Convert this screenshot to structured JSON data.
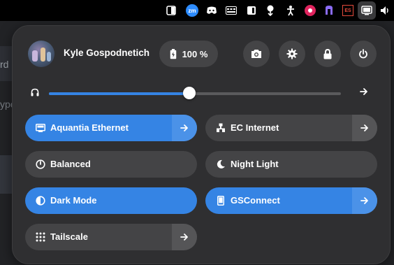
{
  "background": {
    "partial_text_1": "rd",
    "partial_text_2": "ype"
  },
  "topbar": {
    "icons": [
      "sidebar-toggle-icon",
      "zoom-icon",
      "discord-icon",
      "keyboard-layout-icon",
      "panel-icon",
      "tag-icon",
      "accessibility-icon",
      "proton-vpn-icon",
      "vivaldi-icon",
      "steam-icon",
      "network-icon",
      "volume-icon"
    ],
    "zoom_label": "zm",
    "vivaldi_label": "ES"
  },
  "user": {
    "name": "Kyle Gospodnetich"
  },
  "battery": {
    "label": "100 %",
    "level": 100
  },
  "system_buttons": [
    "screenshot-icon",
    "settings-icon",
    "lock-icon",
    "power-icon"
  ],
  "volume": {
    "level_percent": 48
  },
  "tiles": [
    {
      "id": "aquantia",
      "label": "Aquantia Ethernet",
      "icon": "ethernet-icon",
      "active": true,
      "has_menu": true
    },
    {
      "id": "ec-internet",
      "label": "EC Internet",
      "icon": "wired-network-icon",
      "active": false,
      "has_menu": true
    },
    {
      "id": "balanced",
      "label": "Balanced",
      "icon": "power-profile-icon",
      "active": false,
      "has_menu": false
    },
    {
      "id": "night-light",
      "label": "Night Light",
      "icon": "moon-icon",
      "active": false,
      "has_menu": false
    },
    {
      "id": "dark-mode",
      "label": "Dark Mode",
      "icon": "dark-mode-icon",
      "active": true,
      "has_menu": false
    },
    {
      "id": "gsconnect",
      "label": "GSConnect",
      "icon": "phone-icon",
      "active": true,
      "has_menu": true
    },
    {
      "id": "tailscale",
      "label": "Tailscale",
      "icon": "tailscale-icon",
      "active": false,
      "has_menu": true
    }
  ],
  "colors": {
    "accent": "#3584e4",
    "panel": "#2f2f31",
    "tile": "#444446"
  }
}
